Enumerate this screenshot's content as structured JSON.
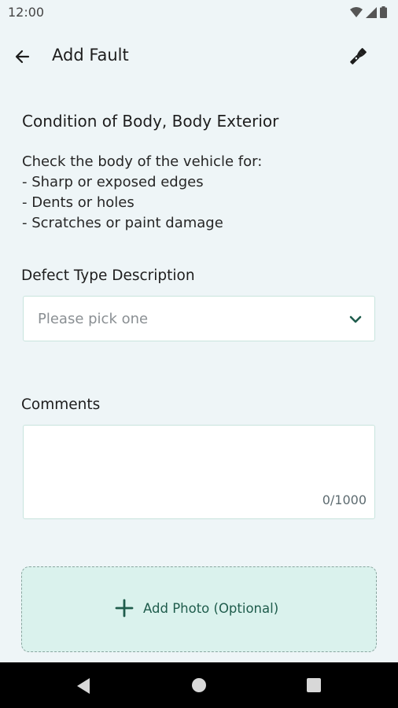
{
  "status_bar": {
    "time": "12:00",
    "icons": [
      "wifi-icon",
      "signal-icon",
      "battery-icon"
    ]
  },
  "app_bar": {
    "title": "Add Fault",
    "back_icon": "arrow-left-icon",
    "action_icon": "flashlight-icon"
  },
  "section": {
    "heading": "Condition of Body, Body Exterior",
    "instructions": [
      "Check the body of the vehicle for:",
      "- Sharp or exposed edges",
      "- Dents or holes",
      "- Scratches or paint damage"
    ]
  },
  "defect_type": {
    "label": "Defect Type Description",
    "placeholder": "Please pick one",
    "icon": "chevron-down-icon"
  },
  "comments": {
    "label": "Comments",
    "value": "",
    "char_count": "0/1000"
  },
  "photo": {
    "label": "Add Photo (Optional)",
    "icon": "plus-icon"
  },
  "colors": {
    "background": "#eef5f7",
    "accent": "#1f5c4c",
    "photo_zone": "#daf2ed",
    "border": "#c8e4dd"
  }
}
